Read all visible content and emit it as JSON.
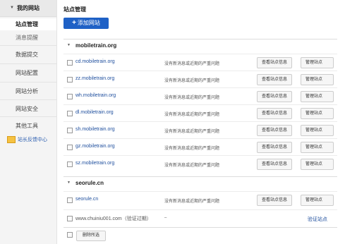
{
  "sidebar": {
    "section_label": "我的网站",
    "sub_items": [
      "站点管理",
      "消息提醒"
    ],
    "items": [
      "数据提交",
      "网站配置",
      "网站分析",
      "网站安全",
      "其他工具"
    ],
    "feedback": "站长反馈中心"
  },
  "main": {
    "title": "站点管理",
    "add_button": "添加网站",
    "groups": [
      {
        "name": "mobiletrain.org",
        "rows": [
          {
            "domain": "cd.mobiletrain.org",
            "message": "没有新消息或近期的严重问题",
            "view": "查看站点信息",
            "manage": "管理站点"
          },
          {
            "domain": "zz.mobiletrain.org",
            "message": "没有新消息或近期的严重问题",
            "view": "查看站点信息",
            "manage": "管理站点"
          },
          {
            "domain": "wh.mobiletrain.org",
            "message": "没有新消息或近期的严重问题",
            "view": "查看站点信息",
            "manage": "管理站点"
          },
          {
            "domain": "dl.mobiletrain.org",
            "message": "没有新消息或近期的严重问题",
            "view": "查看站点信息",
            "manage": "管理站点"
          },
          {
            "domain": "sh.mobiletrain.org",
            "message": "没有新消息或近期的严重问题",
            "view": "查看站点信息",
            "manage": "管理站点"
          },
          {
            "domain": "gz.mobiletrain.org",
            "message": "没有新消息或近期的严重问题",
            "view": "查看站点信息",
            "manage": "管理站点"
          },
          {
            "domain": "sz.mobiletrain.org",
            "message": "没有新消息或近期的严重问题",
            "view": "查看站点信息",
            "manage": "管理站点"
          }
        ]
      },
      {
        "name": "seorule.cn",
        "rows": [
          {
            "domain": "seorule.cn",
            "message": "没有新消息或近期的严重问题",
            "view": "查看站点信息",
            "manage": "管理站点"
          }
        ]
      }
    ],
    "unverified": {
      "domain": "www.chuiniu001.com（验证过期）",
      "message": "–",
      "action": "验证站点"
    },
    "delete_button": "删除所选"
  },
  "colors": {
    "accent": "#1f61c6",
    "link": "#1f4f9e"
  }
}
